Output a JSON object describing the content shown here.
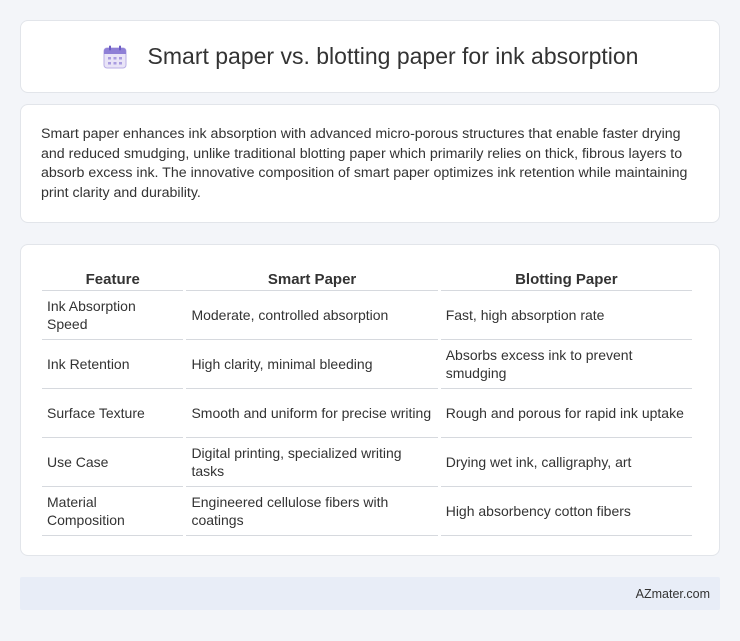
{
  "header": {
    "title": "Smart paper vs. blotting paper for ink absorption",
    "icon": "calendar-icon"
  },
  "intro": {
    "text": "Smart paper enhances ink absorption with advanced micro-porous structures that enable faster drying and reduced smudging, unlike traditional blotting paper which primarily relies on thick, fibrous layers to absorb excess ink. The innovative composition of smart paper optimizes ink retention while maintaining print clarity and durability."
  },
  "table": {
    "headers": [
      "Feature",
      "Smart Paper",
      "Blotting Paper"
    ],
    "rows": [
      [
        "Ink Absorption Speed",
        "Moderate, controlled absorption",
        "Fast, high absorption rate"
      ],
      [
        "Ink Retention",
        "High clarity, minimal bleeding",
        "Absorbs excess ink to prevent smudging"
      ],
      [
        "Surface Texture",
        "Smooth and uniform for precise writing",
        "Rough and porous for rapid ink uptake"
      ],
      [
        "Use Case",
        "Digital printing, specialized writing tasks",
        "Drying wet ink, calligraphy, art"
      ],
      [
        "Material Composition",
        "Engineered cellulose fibers with coatings",
        "High absorbency cotton fibers"
      ]
    ]
  },
  "footer": {
    "brand": "AZmater.com"
  }
}
